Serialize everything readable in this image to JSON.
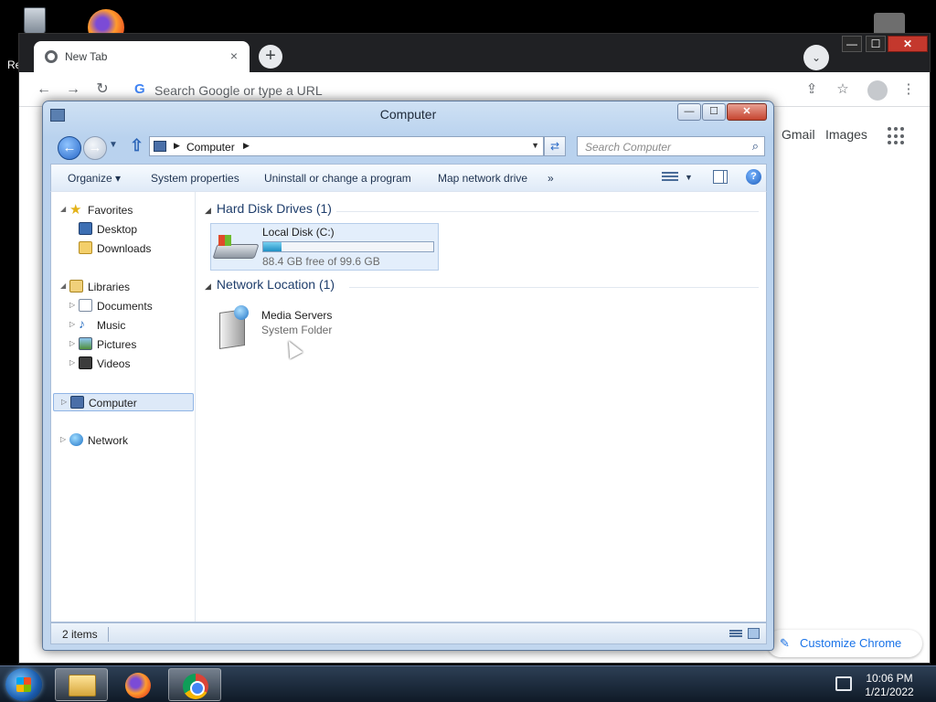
{
  "desktop": {
    "recycle_label": "Re"
  },
  "browser": {
    "tab_title": "New Tab",
    "tab_close": "×",
    "new_tab": "+",
    "tab_search": "⌄",
    "omnibox_placeholder": "Search Google or type a URL",
    "google_g": "G",
    "links": {
      "gmail": "Gmail",
      "images": "Images"
    },
    "customize_label": "Customize Chrome",
    "window_controls": {
      "minimize": "—",
      "maximize": "☐",
      "close": "✕"
    }
  },
  "explorer": {
    "title": "Computer",
    "caption_buttons": {
      "minimize": "—",
      "maximize": "☐",
      "close": "✕"
    },
    "address": {
      "crumb": "Computer"
    },
    "search_placeholder": "Search Computer",
    "commands": [
      "Organize ▾",
      "System properties",
      "Uninstall or change a program",
      "Map network drive",
      "»"
    ],
    "nav": {
      "favorites": "Favorites",
      "desktop": "Desktop",
      "downloads": "Downloads",
      "libraries": "Libraries",
      "documents": "Documents",
      "music": "Music",
      "pictures": "Pictures",
      "videos": "Videos",
      "computer": "Computer",
      "network": "Network"
    },
    "groups": {
      "hard_disks": "Hard Disk Drives (1)",
      "network_location": "Network Location (1)"
    },
    "drive": {
      "name": "Local Disk (C:)",
      "free_text": "88.4 GB free of 99.6 GB",
      "used_fraction": 0.11
    },
    "network_item": {
      "name": "Media Servers",
      "type": "System Folder"
    },
    "status": {
      "items": "2 items"
    }
  },
  "taskbar": {
    "time": "10:06 PM",
    "date": "1/21/2022"
  },
  "colors": {
    "taskbar": "#1a2738",
    "explorer_frame": "#b9d2ee",
    "selection": "#dde9f8",
    "link_blue": "#1a73e8"
  }
}
